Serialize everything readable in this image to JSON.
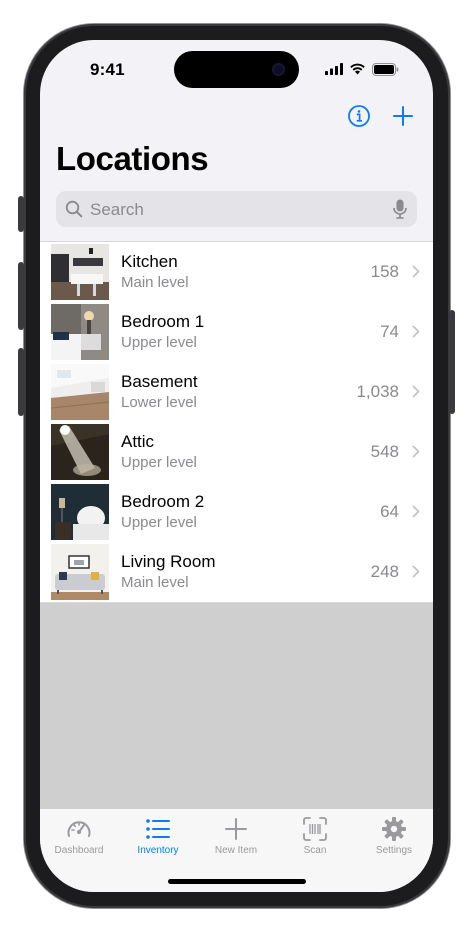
{
  "status": {
    "time": "9:41"
  },
  "header": {
    "title": "Locations"
  },
  "search": {
    "placeholder": "Search"
  },
  "locations": [
    {
      "name": "Kitchen",
      "level": "Main level",
      "count": "158"
    },
    {
      "name": "Bedroom 1",
      "level": "Upper level",
      "count": "74"
    },
    {
      "name": "Basement",
      "level": "Lower level",
      "count": "1,038"
    },
    {
      "name": "Attic",
      "level": "Upper level",
      "count": "548"
    },
    {
      "name": "Bedroom 2",
      "level": "Upper level",
      "count": "64"
    },
    {
      "name": "Living Room",
      "level": "Main level",
      "count": "248"
    }
  ],
  "tabbar": {
    "tabs": [
      {
        "label": "Dashboard",
        "icon": "speedometer-icon"
      },
      {
        "label": "Inventory",
        "icon": "list-icon",
        "active": true
      },
      {
        "label": "New Item",
        "icon": "plus-icon"
      },
      {
        "label": "Scan",
        "icon": "barcode-scan-icon"
      },
      {
        "label": "Settings",
        "icon": "gear-icon"
      }
    ]
  },
  "colors": {
    "accent": "#0a7bff",
    "secondary_text": "#8a8a8e",
    "background": "#f2f2f7"
  }
}
